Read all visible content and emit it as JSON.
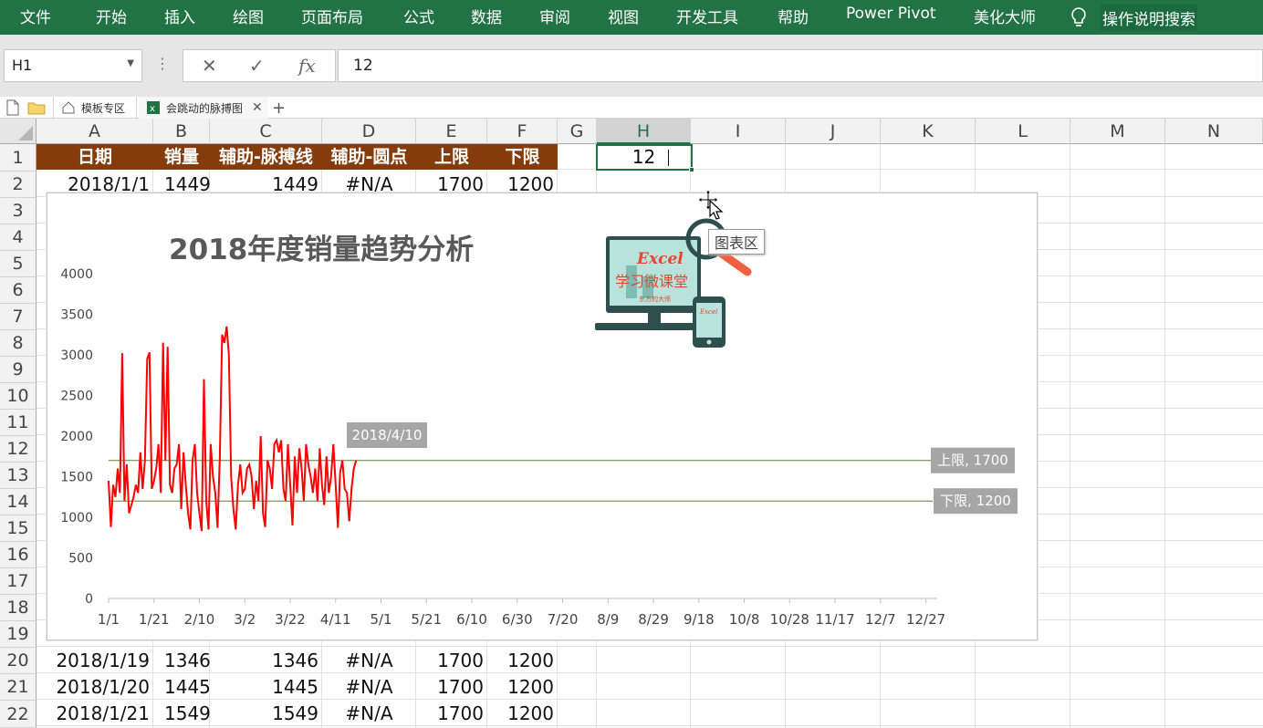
{
  "ribbon": {
    "tabs": [
      "文件",
      "开始",
      "插入",
      "绘图",
      "页面布局",
      "公式",
      "数据",
      "审阅",
      "视图",
      "开发工具",
      "帮助",
      "Power Pivot",
      "美化大师"
    ],
    "search_label": "操作说明搜索"
  },
  "formula": {
    "namebox": "H1",
    "value": "12",
    "fx_label": "fx"
  },
  "tabbar": {
    "tab1": "模板专区",
    "tab2": "会跳动的脉搏图",
    "add": "+"
  },
  "columns": [
    "A",
    "B",
    "C",
    "D",
    "E",
    "F",
    "G",
    "H",
    "I",
    "J",
    "K",
    "L",
    "M",
    "N"
  ],
  "rows": [
    "1",
    "2",
    "3",
    "4",
    "5",
    "6",
    "7",
    "8",
    "9",
    "10",
    "11",
    "12",
    "13",
    "14",
    "15",
    "16",
    "17",
    "18",
    "19",
    "20",
    "21",
    "22"
  ],
  "header": {
    "a": "日期",
    "b": "销量",
    "c": "辅助-脉搏线",
    "d": "辅助-圆点",
    "e": "上限",
    "f": "下限"
  },
  "h1_value": "12",
  "data_rows": [
    {
      "row": "2",
      "a": "2018/1/1",
      "b": "1449",
      "c": "1449",
      "d": "#N/A",
      "e": "1700",
      "f": "1200"
    },
    {
      "row": "20",
      "a": "2018/1/19",
      "b": "1346",
      "c": "1346",
      "d": "#N/A",
      "e": "1700",
      "f": "1200"
    },
    {
      "row": "21",
      "a": "2018/1/20",
      "b": "1445",
      "c": "1445",
      "d": "#N/A",
      "e": "1700",
      "f": "1200"
    },
    {
      "row": "22",
      "a": "2018/1/21",
      "b": "1549",
      "c": "1549",
      "d": "#N/A",
      "e": "1700",
      "f": "1200"
    }
  ],
  "tooltip": "图表区",
  "colors": {
    "ribbon": "#217346",
    "header_fill": "#843c0c",
    "line": "#ff0000",
    "limit_line": "#548235",
    "label_bg": "#a6a6a6"
  },
  "chart_data": {
    "type": "line",
    "title": "2018年度销量趋势分析",
    "ylim": [
      0,
      4000
    ],
    "yticks": [
      "0",
      "500",
      "1000",
      "1500",
      "2000",
      "2500",
      "3000",
      "3500",
      "4000"
    ],
    "xticks": [
      "1/1",
      "1/21",
      "2/10",
      "3/2",
      "3/22",
      "4/11",
      "5/1",
      "5/21",
      "6/10",
      "6/30",
      "7/20",
      "8/9",
      "8/29",
      "9/18",
      "10/8",
      "10/28",
      "11/17",
      "12/7",
      "12/27"
    ],
    "x_start_day": 0,
    "x_span_days": 365,
    "series": [
      {
        "name": "销量",
        "values": [
          1449,
          880,
          1400,
          1250,
          1600,
          1300,
          3020,
          1200,
          1650,
          1050,
          1150,
          1250,
          1400,
          1300,
          1800,
          1350,
          1700,
          2950,
          3030,
          1350,
          1450,
          1600,
          1900,
          1300,
          3150,
          1700,
          3100,
          1400,
          1300,
          1600,
          1650,
          1900,
          1100,
          1800,
          1400,
          1050,
          850,
          1700,
          1900,
          1300,
          1050,
          830,
          2700,
          1200,
          850,
          1900,
          1500,
          1300,
          870,
          1750,
          3250,
          3150,
          3350,
          3000,
          1500,
          1100,
          850,
          1400,
          1650,
          1300,
          1350,
          1600,
          1650,
          1500,
          1100,
          1450,
          1200,
          2000,
          1050,
          880,
          1700,
          1600,
          1350,
          1900,
          1950,
          1800,
          1950,
          1350,
          1200,
          1900,
          1400,
          900,
          1750,
          1300,
          1850,
          1600,
          1200,
          1900,
          1650,
          1500,
          1300,
          1600,
          1200,
          1850,
          1400,
          1150,
          1750,
          1300,
          1500,
          1900,
          1400,
          870,
          1550,
          1700,
          1350,
          1300,
          950,
          1350,
          1600,
          1700
        ]
      },
      {
        "name": "上限",
        "values": [
          1700
        ]
      },
      {
        "name": "下限",
        "values": [
          1200
        ]
      }
    ],
    "marker": {
      "date": "2018/4/10",
      "value": 1700
    },
    "limit_labels": {
      "upper": "上限, 1700",
      "lower": "下限, 1200"
    },
    "logo": {
      "line1": "Excel",
      "line2": "学习微课堂",
      "line3": "东方的大师"
    }
  }
}
